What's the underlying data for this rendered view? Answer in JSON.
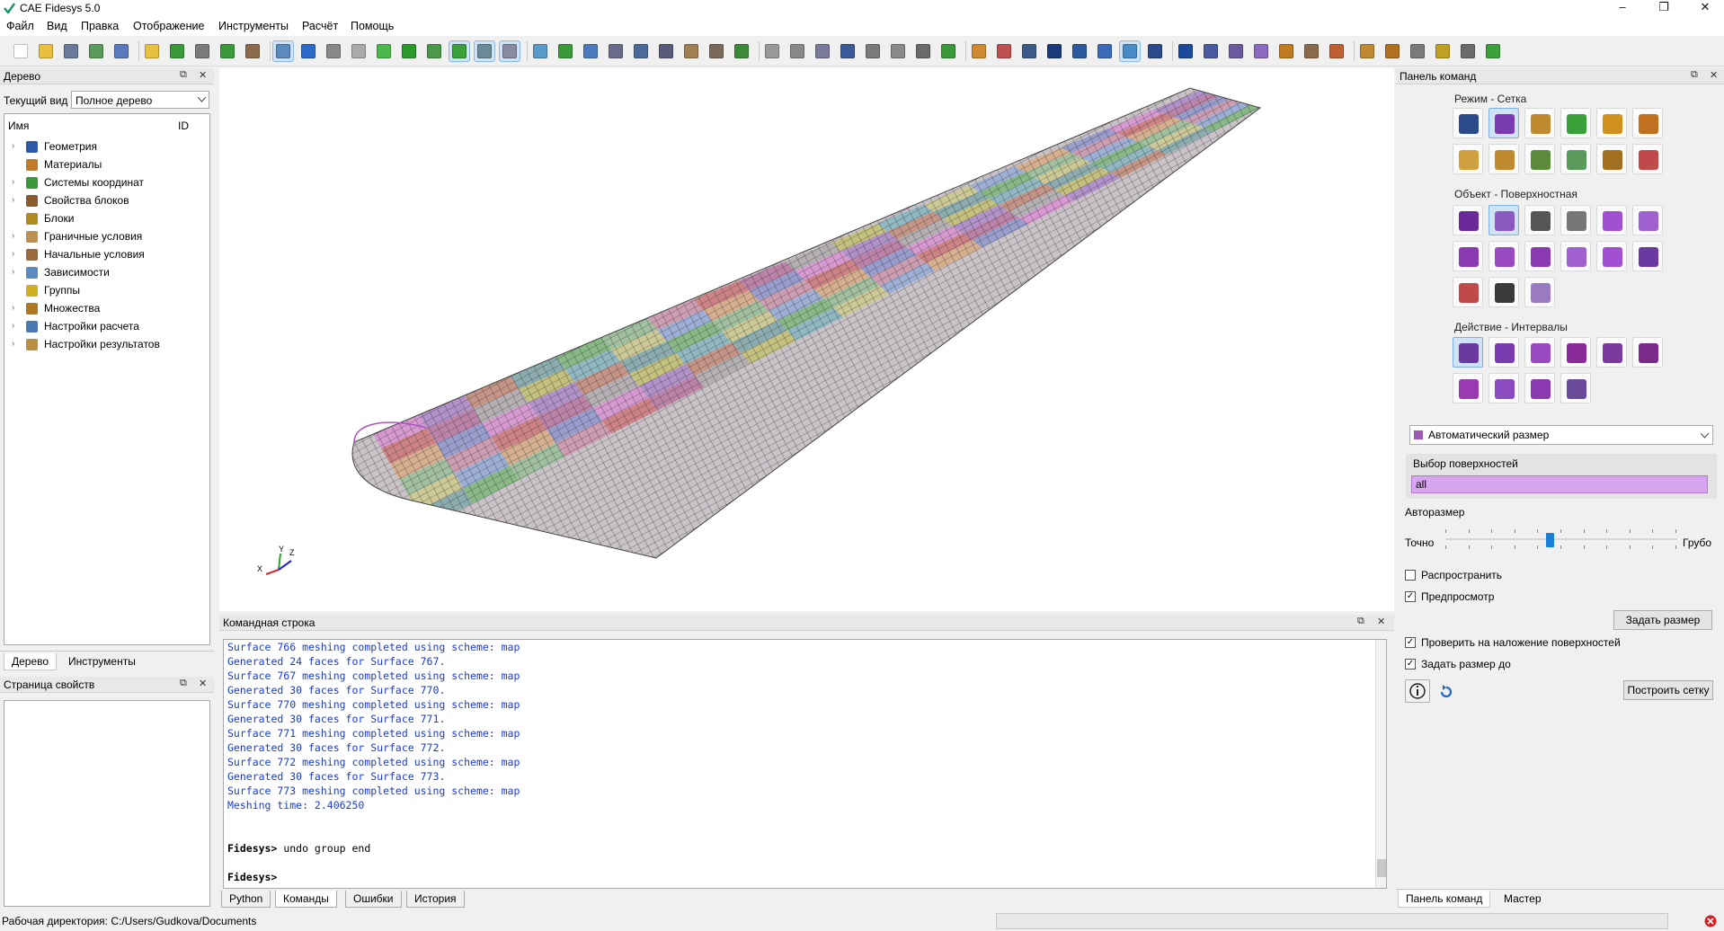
{
  "window": {
    "title": "CAE Fidesys 5.0",
    "minimize": "–",
    "maximize": "❐",
    "close": "✕"
  },
  "menu": [
    "Файл",
    "Вид",
    "Правка",
    "Отображение",
    "Инструменты",
    "Расчёт",
    "Помощь"
  ],
  "tree_panel": {
    "title": "Дерево",
    "view_label": "Текущий вид",
    "view_value": "Полное дерево",
    "col_name": "Имя",
    "col_id": "ID",
    "items": [
      {
        "label": "Геометрия",
        "color": "#2a5aa8"
      },
      {
        "label": "Материалы",
        "color": "#c07a2a"
      },
      {
        "label": "Системы координат",
        "color": "#3a9a3a"
      },
      {
        "label": "Свойства блоков",
        "color": "#8a5a2a"
      },
      {
        "label": "Блоки",
        "color": "#b08a20"
      },
      {
        "label": "Граничные условия",
        "color": "#c09050"
      },
      {
        "label": "Начальные условия",
        "color": "#9a6a3a"
      },
      {
        "label": "Зависимости",
        "color": "#5a8ac0"
      },
      {
        "label": "Группы",
        "color": "#d0b020"
      },
      {
        "label": "Множества",
        "color": "#b07820"
      },
      {
        "label": "Настройки расчета",
        "color": "#4a7ab0"
      },
      {
        "label": "Настройки результатов",
        "color": "#b89040"
      }
    ],
    "tabs": [
      "Дерево",
      "Инструменты"
    ]
  },
  "props_panel": {
    "title": "Страница свойств"
  },
  "console": {
    "title": "Командная строка",
    "lines": [
      "Surface 766 meshing completed using scheme: map",
      "Generated 24 faces for Surface 767.",
      "Surface 767 meshing completed using scheme: map",
      "Generated 30 faces for Surface 770.",
      "Surface 770 meshing completed using scheme: map",
      "Generated 30 faces for Surface 771.",
      "Surface 771 meshing completed using scheme: map",
      "Generated 30 faces for Surface 772.",
      "Surface 772 meshing completed using scheme: map",
      "Generated 30 faces for Surface 773.",
      "Surface 773 meshing completed using scheme: map",
      "Meshing time: 2.406250"
    ],
    "prompt1": "Fidesys>",
    "cmd1": " undo group end",
    "prompt2": "Fidesys>",
    "tabs": [
      "Python",
      "Команды",
      "Ошибки",
      "История"
    ]
  },
  "command_panel": {
    "title": "Панель команд",
    "mode_title": "Режим - Сетка",
    "object_title": "Объект - Поверхностная",
    "action_title": "Действие - Интервалы",
    "dropdown": "Автоматический размер",
    "surface_select_label": "Выбор поверхностей",
    "surface_select_value": "all",
    "autosize_label": "Авторазмер",
    "slider_left": "Точно",
    "slider_right": "Грубо",
    "slider_level": 0.45,
    "propagate_label": "Распространить",
    "propagate_checked": false,
    "preview_label": "Предпросмотр",
    "preview_checked": true,
    "set_size_button": "Задать размер",
    "check_overlap_label": "Проверить на наложение поверхностей",
    "check_overlap_checked": true,
    "set_size_to_label": "Задать размер до",
    "set_size_to_checked": true,
    "build_mesh_button": "Построить сетку",
    "tabs": [
      "Панель команд",
      "Мастер"
    ]
  },
  "status": {
    "workdir": "Рабочая директория: C:/Users/Gudkova/Documents"
  },
  "axes": {
    "x": "X",
    "y": "Y",
    "z": "Z"
  },
  "checkmark": "✓",
  "dock_float_icon": "⧉",
  "dock_close_icon": "✕",
  "expand_arrow": "›"
}
